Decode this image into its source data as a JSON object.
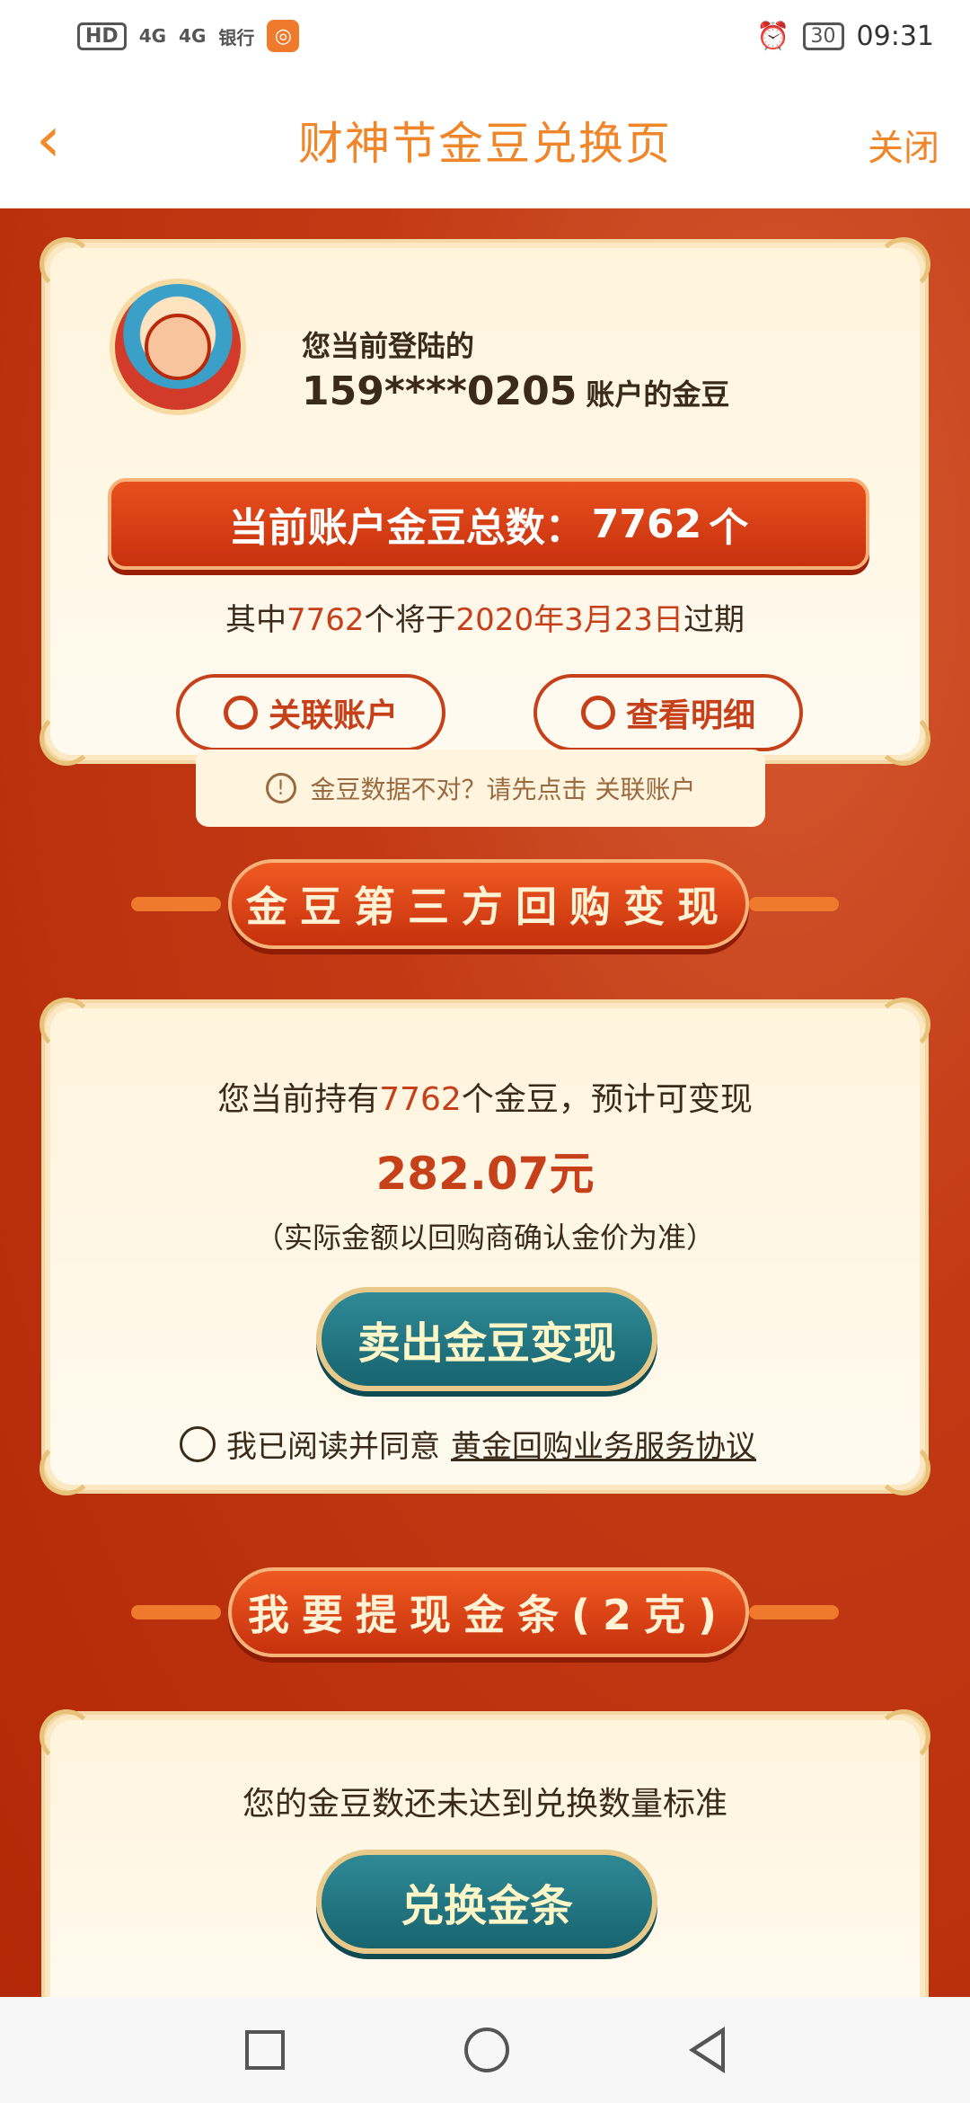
{
  "statusbar": {
    "left_chips": [
      "HD",
      "4G",
      "4G"
    ],
    "bank_label": "银行",
    "time": "09:31",
    "battery": "30",
    "icons": [
      "alarm-icon",
      "battery-icon",
      "signal-icon",
      "app-badge-icon"
    ]
  },
  "navbar": {
    "title": "财神节金豆兑换页",
    "close_label": "关闭",
    "back_icon": "chevron-left-icon"
  },
  "account_card": {
    "login_label": "您当前登陆的",
    "account_masked": "159****0205",
    "account_suffix": "账户的金豆",
    "total_prefix": "当前账户金豆总数：",
    "total_value": "7762",
    "total_unit": "个",
    "expire_pre": "其中",
    "expire_count": "7762",
    "expire_mid": "个将于",
    "expire_date": "2020年3月23日",
    "expire_post": "过期",
    "link_account_label": "关联账户",
    "view_detail_label": "查看明细"
  },
  "tip": {
    "text": "金豆数据不对？请先点击 关联账户"
  },
  "section1": {
    "title": "金豆第三方回购变现",
    "hold_pre": "您当前持有",
    "hold_value": "7762",
    "hold_post": "个金豆，预计可变现",
    "cash_amount": "282.07元",
    "cash_note": "（实际金额以回购商确认金价为准）",
    "sell_button": "卖出金豆变现",
    "agree_text": "我已阅读并同意",
    "agree_link": "黄金回购业务服务协议"
  },
  "section2": {
    "title": "我要提现金条(2克)",
    "info": "您的金豆数还未达到兑换数量标准",
    "exchange_button": "兑换金条"
  },
  "colors": {
    "accent": "#f0862a",
    "primary_red": "#c6401a",
    "teal": "#17646f",
    "background": "#b8290a"
  }
}
